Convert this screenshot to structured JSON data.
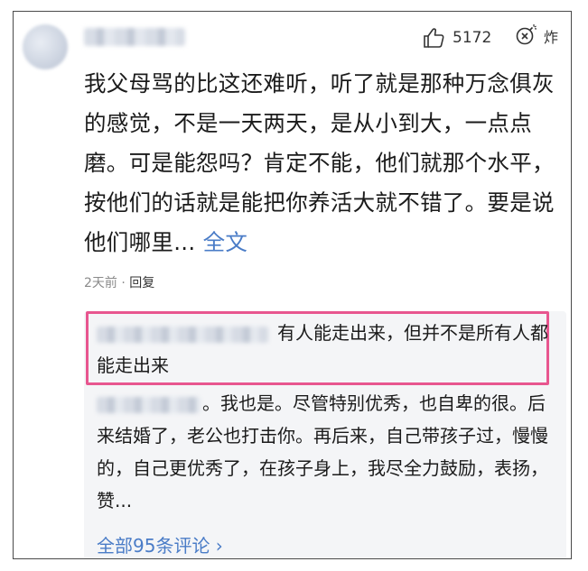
{
  "comment": {
    "likes": "5172",
    "boom_label": "炸",
    "text": "我父母骂的比这还难听，听了就是那种万念俱灰的感觉，不是一天两天，是从小到大，一点点磨。可是能怨吗？肯定不能，他们就那个水平，按他们的话就是能把你养活大就不错了。要是说他们哪里...",
    "full_text_link": "全文",
    "time": "2天前",
    "separator": "·",
    "reply_label": "回复"
  },
  "replies": [
    {
      "text": "有人能走出来，但并不是所有人都能走出来"
    },
    {
      "text": "。我也是。尽管特别优秀，也自卑的很。后来结婚了，老公也打击你。再后来，自己带孩子过，慢慢的，自己更优秀了，在孩子身上，我尽全力鼓励，表扬，赞..."
    }
  ],
  "all_comments_link": "全部95条评论 ›",
  "colors": {
    "link": "#4a7cc7",
    "highlight_border": "#e8568f",
    "reply_bg": "#f4f5f7"
  },
  "icons": [
    "thumbs-up-icon",
    "bomb-icon"
  ]
}
